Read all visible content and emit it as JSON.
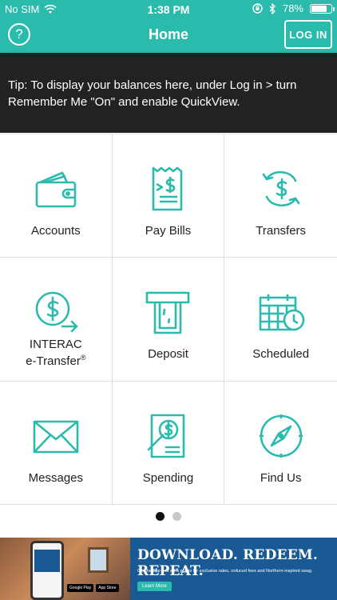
{
  "status_bar": {
    "carrier": "No SIM",
    "time": "1:38 PM",
    "battery_percent": "78%",
    "battery_level": 0.78
  },
  "nav": {
    "help_glyph": "?",
    "title": "Home",
    "login_label": "LOG IN"
  },
  "tip": {
    "text": "Tip: To display your balances here, under Log in > turn Remember Me \"On\" and enable QuickView."
  },
  "tiles": [
    {
      "label": "Accounts",
      "icon": "wallet-icon"
    },
    {
      "label": "Pay Bills",
      "icon": "bill-icon"
    },
    {
      "label": "Transfers",
      "icon": "transfer-icon"
    },
    {
      "label_line1": "INTERAC",
      "label_line2": "e-Transfer",
      "label_sup": "®",
      "icon": "etransfer-icon"
    },
    {
      "label": "Deposit",
      "icon": "atm-deposit-icon"
    },
    {
      "label": "Scheduled",
      "icon": "calendar-clock-icon"
    },
    {
      "label": "Messages",
      "icon": "envelope-icon"
    },
    {
      "label": "Spending",
      "icon": "spending-report-icon"
    },
    {
      "label": "Find Us",
      "icon": "compass-icon"
    }
  ],
  "pagination": {
    "pages": 2,
    "current": 1
  },
  "ad": {
    "headline": "DOWNLOAD. REDEEM. REPEAT.",
    "subtext": "Get the app and earn points for exclusive rates, reduced fees and Northern-inspired swag.",
    "cta": "Learn More",
    "store1": "Google Play",
    "store2": "App Store"
  },
  "colors": {
    "accent": "#2bbbad",
    "tip_bg": "#222222",
    "ad_bg": "#1a5a94"
  }
}
